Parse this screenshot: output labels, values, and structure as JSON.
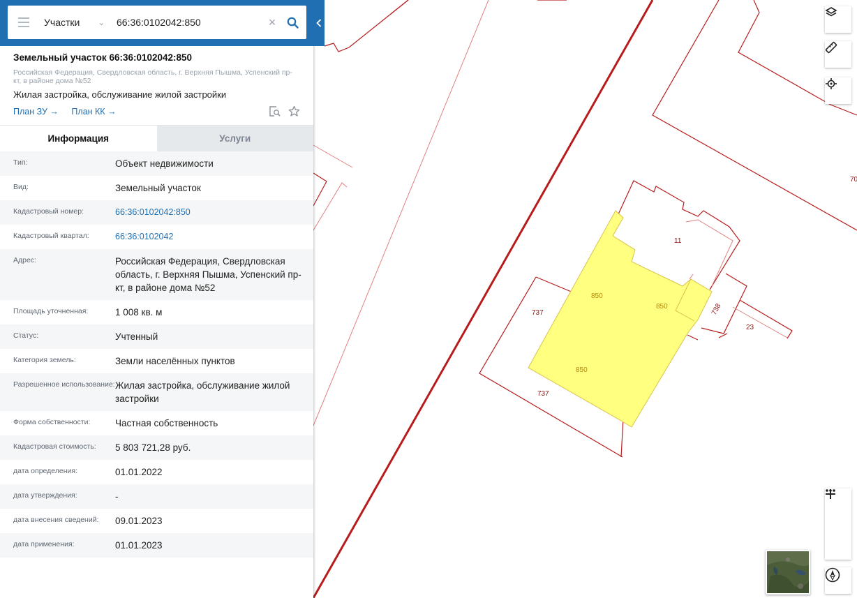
{
  "search": {
    "type_label": "Участки",
    "value": "66:36:0102042:850"
  },
  "object": {
    "title": "Земельный участок 66:36:0102042:850",
    "address": "Российская Федерация, Свердловская область, г. Верхняя Пышма, Успенский пр-кт, в районе дома №52",
    "use": "Жилая застройка, обслуживание жилой застройки",
    "links": [
      "План ЗУ →",
      "План КК →"
    ]
  },
  "tabs": [
    "Информация",
    "Услуги"
  ],
  "info_rows": [
    {
      "label": "Тип:",
      "value": "Объект недвижимости"
    },
    {
      "label": "Вид:",
      "value": "Земельный участок"
    },
    {
      "label": "Кадастровый номер:",
      "value": "66:36:0102042:850"
    },
    {
      "label": "Кадастровый квартал:",
      "value": "66:36:0102042"
    },
    {
      "label": "Адрес:",
      "value": "Российская Федерация, Свердловская область, г. Верхняя Пышма, Успенский пр-кт, в районе дома №52"
    },
    {
      "label": "Площадь уточненная:",
      "value": "1 008 кв. м"
    },
    {
      "label": "Статус:",
      "value": "Учтенный"
    },
    {
      "label": "Категория земель:",
      "value": "Земли населённых пунктов"
    },
    {
      "label": "Разрешенное использование:",
      "value": "Жилая застройка, обслуживание жилой застройки"
    },
    {
      "label": "Форма собственности:",
      "value": "Частная собственность"
    },
    {
      "label": "Кадастровая стоимость:",
      "value": "5 803 721,28 руб."
    },
    {
      "label": "дата определения:",
      "value": "01.01.2022"
    },
    {
      "label": "дата утверждения:",
      "value": "-"
    },
    {
      "label": "дата внесения сведений:",
      "value": "09.01.2023"
    },
    {
      "label": "дата применения:",
      "value": "01.01.2023"
    }
  ],
  "map_labels": {
    "p850_a": "850",
    "p850_b": "850",
    "p850_c": "850",
    "p11": "11",
    "p737_a": "737",
    "p737_b": "737",
    "p738": "738",
    "p23": "23",
    "p70": "70"
  },
  "colors": {
    "header_blue": "#1f6fb2",
    "parcel_line": "#b71c1c",
    "selected_fill": "#ffff80",
    "link_blue": "#1f6fb2"
  },
  "icons": [
    "menu-icon",
    "chevron-down-icon",
    "close-icon",
    "search-icon",
    "chevron-left-icon",
    "plan-search-icon",
    "star-icon",
    "layers-icon",
    "ruler-icon",
    "locate-icon",
    "plus-icon",
    "more-icon",
    "minus-icon",
    "compass-icon"
  ]
}
